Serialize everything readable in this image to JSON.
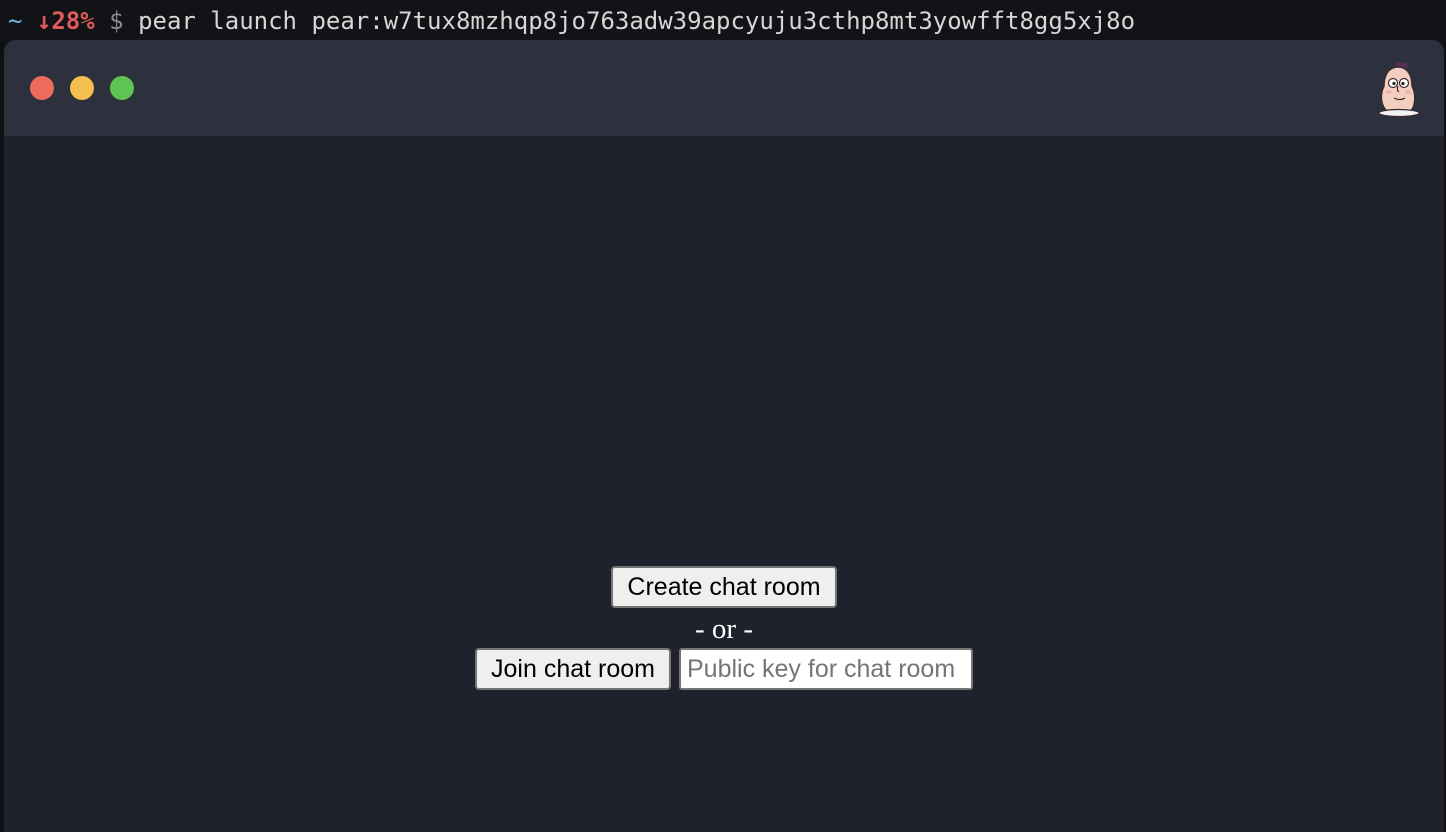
{
  "terminal": {
    "tilde": "~",
    "battery": "↓28%",
    "dollar": "$",
    "command": "pear launch pear:w7tux8mzhqp8jo763adw39apcyuju3cthp8mt3yowfft8gg5xj8o"
  },
  "window": {
    "controls": [
      "close",
      "minimize",
      "maximize"
    ],
    "logo": "pear-mascot-icon"
  },
  "main": {
    "create_label": "Create chat room",
    "or_label": "- or -",
    "join_label": "Join chat room",
    "key_placeholder": "Public key for chat room",
    "key_value": ""
  },
  "colors": {
    "titlebar": "#2d313d",
    "background": "#1f222d",
    "close": "#ed6a5e",
    "minimize": "#f5bf4f",
    "maximize": "#61c554"
  }
}
